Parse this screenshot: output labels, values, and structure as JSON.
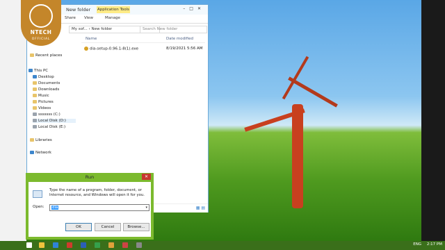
{
  "logo": {
    "name": "NTECH",
    "sub": "OFFICIAL"
  },
  "explorer": {
    "title": "New folder",
    "application_tools": "Application Tools",
    "tabs": [
      "Share",
      "View",
      "Manage"
    ],
    "address": "My sof... › New folder",
    "search_placeholder": "Search New folder",
    "nav_items": [
      "Recent places",
      "This PC",
      "Desktop",
      "Documents",
      "Downloads",
      "Music",
      "Pictures",
      "Videos",
      "sssssss (C:)",
      "Local Disk (D:)",
      "Local Disk (E:)",
      "Libraries",
      "Network"
    ],
    "columns": [
      "Name",
      "Date modified"
    ],
    "files": [
      {
        "name": "dia-setup-0.96.1-8(1).exe",
        "date": "8/19/2021 5:56 AM"
      }
    ]
  },
  "run": {
    "title": "Run",
    "description": "Type the name of a program, folder, document, or Internet resource, and Windows will open it for you.",
    "open_label": "Open:",
    "open_value": "dia",
    "ok": "OK",
    "cancel": "Cancel",
    "browse": "Browse..."
  },
  "taskbar": {
    "lang": "ENG",
    "time": "2:17 PM"
  }
}
